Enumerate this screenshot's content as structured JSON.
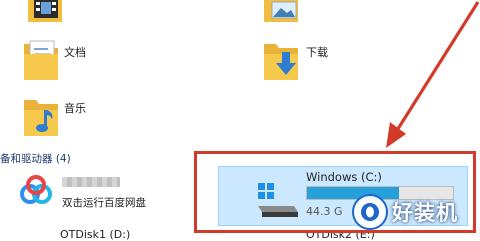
{
  "folders": {
    "documents_label": "文档",
    "downloads_label": "下载",
    "music_label": "音乐"
  },
  "devices_section": {
    "header": "备和驱动器 (4)"
  },
  "drives": {
    "baidu_label": "双击运行百度网盘",
    "otdisk1_label": "OTDisk1 (D:)",
    "windows": {
      "name": "Windows (C:)",
      "free_text": "44.3 G",
      "usage_fraction": 0.63
    },
    "otdisk2_label": "OTDisk2 (E:)"
  },
  "watermark": {
    "text": "好装机"
  },
  "colors": {
    "annotation_red": "#d23a2a",
    "selection_bg": "#cce8ff",
    "usage_bar": "#26a0da",
    "folder_yellow": "#f6c94c"
  },
  "icons": [
    "folder-video-icon",
    "folder-pictures-icon",
    "folder-documents-icon",
    "folder-downloads-icon",
    "folder-music-icon",
    "baidu-netdisk-icon",
    "windows-drive-icon",
    "watermark-logo-icon",
    "annotation-arrow"
  ]
}
